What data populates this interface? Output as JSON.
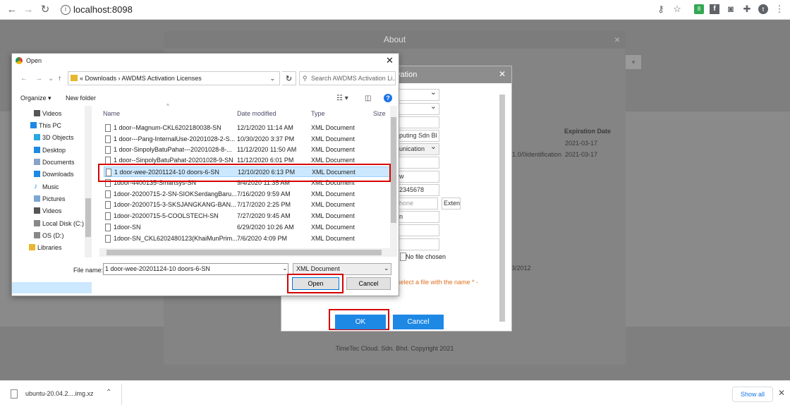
{
  "browser": {
    "url": "localhost:8098",
    "extension_badge": "8"
  },
  "about_modal": {
    "title": "About",
    "expiration_header": "Expiration Date",
    "expiration_row1": "2021-03-17",
    "row2_text": "1.0/0identification",
    "expiration_row2": "2021-03-17",
    "date_fragment": "3/2012",
    "copyright": "TimeTec Cloud. Sdn. Bhd.   Copyright 2021"
  },
  "activation_dialog": {
    "title_fragment": "vation",
    "field_company": "puting Sdn Bl",
    "field_industry": "unication",
    "field_city": "w",
    "field_phone": "2345678",
    "field_phone2": "hone",
    "field_ext": "Exten",
    "field_h": "n",
    "no_file": "No file chosen",
    "note": "select a file with the name * -",
    "ok_label": "OK",
    "cancel_label": "Cancel"
  },
  "open_dialog": {
    "title": "Open",
    "path": "«  Downloads  ›  AWDMS Activation Licenses",
    "search_placeholder": "Search AWDMS Activation Li...",
    "organize": "Organize ▾",
    "new_folder": "New folder",
    "sidebar": [
      "Videos",
      "This PC",
      "3D Objects",
      "Desktop",
      "Documents",
      "Downloads",
      "Music",
      "Pictures",
      "Videos",
      "Local Disk (C:)",
      "OS (D:)",
      "Libraries"
    ],
    "columns": {
      "name": "Name",
      "date": "Date modified",
      "type": "Type",
      "size": "Size"
    },
    "files": [
      {
        "name": "1 door--Magnum-CKL6202180038-SN",
        "date": "12/1/2020 11:14 AM",
        "type": "XML Document"
      },
      {
        "name": "1 door---Pang-InternalUse-20201028-2-S...",
        "date": "10/30/2020 3:37 PM",
        "type": "XML Document"
      },
      {
        "name": "1 door-SinpolyBatuPahat---20201028-8-...",
        "date": "11/12/2020 11:50 AM",
        "type": "XML Document"
      },
      {
        "name": "1 door--SinpolyBatuPahat-20201028-9-SN",
        "date": "11/12/2020 6:01 PM",
        "type": "XML Document"
      },
      {
        "name": "1 door-wee-20201124-10 doors-6-SN",
        "date": "12/10/2020 6:13 PM",
        "type": "XML Document"
      },
      {
        "name": "1door-4400135-Smartsys-SN",
        "date": "9/4/2020 11:35 AM",
        "type": "XML Document"
      },
      {
        "name": "1door-20200715-2-SN-SIOKSerdangBaru...",
        "date": "7/16/2020 9:59 AM",
        "type": "XML Document"
      },
      {
        "name": "1door-20200715-3-SKSJANGKANG-BAN...",
        "date": "7/17/2020 2:25 PM",
        "type": "XML Document"
      },
      {
        "name": "1door-20200715-5-COOLSTECH-SN",
        "date": "7/27/2020 9:45 AM",
        "type": "XML Document"
      },
      {
        "name": "1door-SN",
        "date": "6/29/2020 10:26 AM",
        "type": "XML Document"
      },
      {
        "name": "1door-SN_CKL6202480123(KhaiMunPrim...",
        "date": "7/6/2020 4:09 PM",
        "type": "XML Document"
      }
    ],
    "file_name_label": "File name:",
    "file_name_value": "1 door-wee-20201124-10 doors-6-SN",
    "file_type": "XML Document",
    "open_label": "Open",
    "cancel_label": "Cancel"
  },
  "download_bar": {
    "file": "ubuntu-20.04.2....img.xz",
    "show_all": "Show all"
  }
}
